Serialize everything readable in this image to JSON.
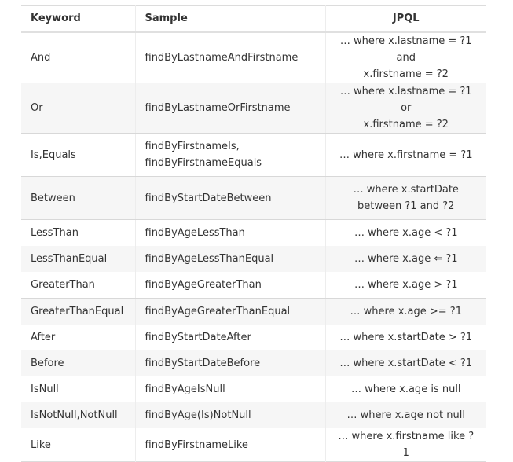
{
  "table": {
    "headers": [
      "Keyword",
      "Sample",
      "JPQL"
    ],
    "rows": [
      {
        "keyword": "And",
        "sample": [
          "findByLastnameAndFirstname"
        ],
        "jpql": [
          "… where x.lastname = ?1 and",
          "x.firstname = ?2"
        ]
      },
      {
        "keyword": "Or",
        "sample": [
          "findByLastnameOrFirstname"
        ],
        "jpql": [
          "… where x.lastname = ?1 or",
          "x.firstname = ?2"
        ]
      },
      {
        "keyword": "Is,Equals",
        "sample": [
          "findByFirstnameIs,",
          "findByFirstnameEquals"
        ],
        "jpql": [
          "… where x.firstname = ?1"
        ]
      },
      {
        "keyword": "Between",
        "sample": [
          "findByStartDateBetween"
        ],
        "jpql": [
          "… where x.startDate",
          "between ?1 and ?2"
        ]
      },
      {
        "keyword": "LessThan",
        "sample": [
          "findByAgeLessThan"
        ],
        "jpql": [
          "… where x.age < ?1"
        ]
      },
      {
        "keyword": "LessThanEqual",
        "sample": [
          "findByAgeLessThanEqual"
        ],
        "jpql": [
          "… where x.age ⇐ ?1"
        ]
      },
      {
        "keyword": "GreaterThan",
        "sample": [
          "findByAgeGreaterThan"
        ],
        "jpql": [
          "… where x.age > ?1"
        ]
      },
      {
        "keyword": "GreaterThanEqual",
        "sample": [
          "findByAgeGreaterThanEqual"
        ],
        "jpql": [
          "… where x.age >= ?1"
        ]
      },
      {
        "keyword": "After",
        "sample": [
          "findByStartDateAfter"
        ],
        "jpql": [
          "… where x.startDate > ?1"
        ]
      },
      {
        "keyword": "Before",
        "sample": [
          "findByStartDateBefore"
        ],
        "jpql": [
          "… where x.startDate < ?1"
        ]
      },
      {
        "keyword": "IsNull",
        "sample": [
          "findByAgeIsNull"
        ],
        "jpql": [
          "… where x.age is null"
        ]
      },
      {
        "keyword": "IsNotNull,NotNull",
        "sample": [
          "findByAge(Is)NotNull"
        ],
        "jpql": [
          "… where x.age not null"
        ]
      },
      {
        "keyword": "Like",
        "sample": [
          "findByFirstnameLike"
        ],
        "jpql": [
          "… where x.firstname like ?1"
        ]
      }
    ]
  }
}
